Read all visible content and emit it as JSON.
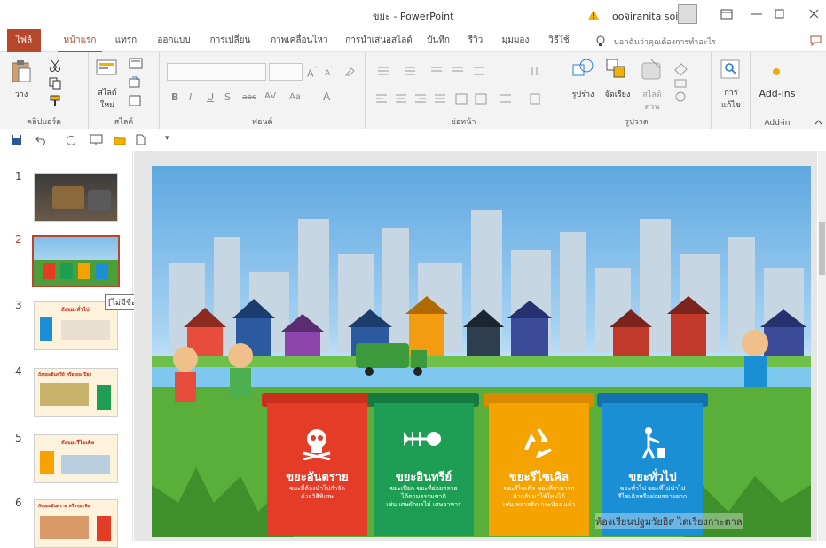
{
  "window": {
    "title": "ขยะ - PowerPoint",
    "user_name": "ooจiranita soisai"
  },
  "tabs": [
    {
      "label": "ไฟล์"
    },
    {
      "label": "หน้าแรก"
    },
    {
      "label": "แทรก"
    },
    {
      "label": "ออกแบบ"
    },
    {
      "label": "การเปลี่ยน"
    },
    {
      "label": "ภาพเคลื่อนไหว"
    },
    {
      "label": "การนำเสนอสไลด์"
    },
    {
      "label": "บันทึก"
    },
    {
      "label": "รีวิว"
    },
    {
      "label": "มุมมอง"
    },
    {
      "label": "วิธีใช้"
    }
  ],
  "search": {
    "placeholder": "บอกฉันว่าคุณต้องการทำอะไร"
  },
  "ribbon": {
    "groups": {
      "clipboard": "คลิปบอร์ด",
      "slides": "สไลด์",
      "font": "ฟอนต์",
      "paragraph": "ย่อหน้า",
      "drawing": "รูปวาด",
      "addin": "Add-in"
    },
    "paste_label": "วาง",
    "new_slide_label": "สไลด์\nใหม่",
    "shapes_label": "รูปร่าง",
    "arrange_label": "จัดเรียง",
    "quick_styles_label": "สไลด์\nด่วน",
    "editing_label": "การ\nแก้ไข",
    "addins_label": "Add-ins"
  },
  "thumbnails": [
    {
      "num": "1",
      "label": ""
    },
    {
      "num": "2",
      "label": ""
    },
    {
      "num": "3",
      "label": "ถังขยะทั่วไป"
    },
    {
      "num": "4",
      "label": "ถังขยะอินทรีย์ หรือขยะเปียก"
    },
    {
      "num": "5",
      "label": "ถังขยะรีไซเคิล"
    },
    {
      "num": "6",
      "label": "ถังขยะอันตราย หรือขยะพิษ"
    }
  ],
  "tooltip": "[ไม่มีชื่อเรื่อง]",
  "slide": {
    "bins": [
      {
        "label": "ขยะอันตราย",
        "text": "ขยะที่ต้องนำไปกำจัด\nด้วยวิธีพิเศษ",
        "color": "#e53c27"
      },
      {
        "label": "ขยะอินทรีย์",
        "text": "ขยะเปียก ขยะที่ย่อยสลาย\nได้ตามธรรมชาติ\nเช่น เศษผักผลไม้ เศษอาหาร",
        "color": "#1e9e54"
      },
      {
        "label": "ขยะรีไซเคิล",
        "text": "ขยะรีไซเคิล ขยะที่สามารถ\nนำกลับมาใช้ใหม่ได้\nเช่น พลาสติก กระป๋อง แก้ว",
        "color": "#f5a300"
      },
      {
        "label": "ขยะทั่วไป",
        "text": "ขยะทั่วไป ขยะที่ไม่นำไป\nรีไซเคิลหรือย่อยสลายยาก",
        "color": "#1a8fd6"
      }
    ],
    "watermark": "ห้องเรียนปฐมวัยอิส ไดเรียงกาะตาล"
  }
}
